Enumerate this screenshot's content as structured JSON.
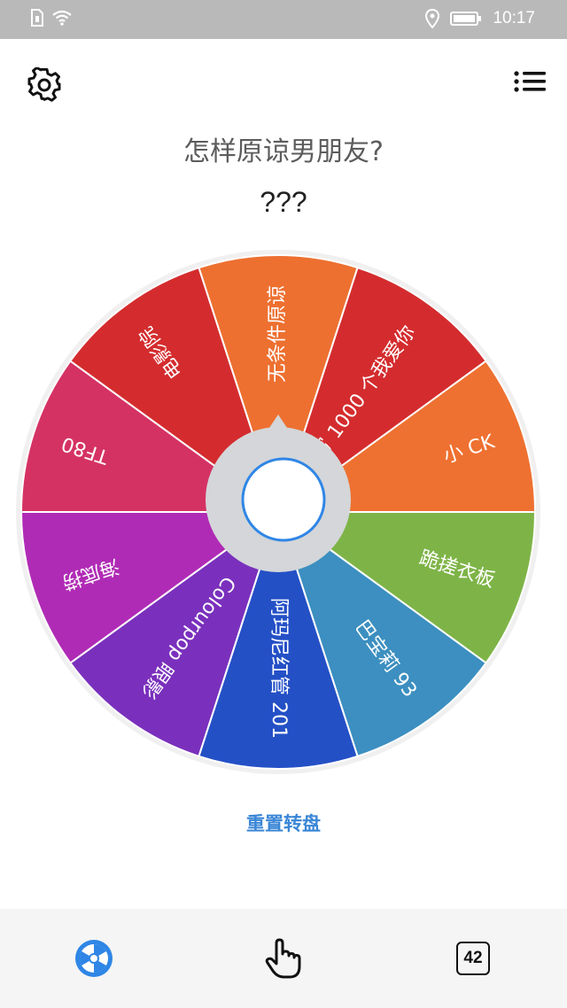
{
  "status_bar": {
    "time": "10:17",
    "icons": [
      "sim-icon",
      "wifi-icon",
      "location-icon",
      "battery-icon"
    ]
  },
  "toolbar": {
    "settings_icon": "gear-icon",
    "menu_icon": "list-icon"
  },
  "question": "怎样原谅男朋友?",
  "result": "???",
  "wheel": {
    "segments": [
      {
        "label": "无条件原谅",
        "color": "#ed7030"
      },
      {
        "label": "写 1000 个我爱你",
        "color": "#d42c2e"
      },
      {
        "label": "小 CK",
        "color": "#ee7131"
      },
      {
        "label": "跪搓衣板",
        "color": "#7eb447"
      },
      {
        "label": "巴宝莉 93",
        "color": "#3c8fc0"
      },
      {
        "label": "阿玛尼红管 201",
        "color": "#2450c6"
      },
      {
        "label": "Colourpop 眼影",
        "color": "#7a30bc"
      },
      {
        "label": "海底捞",
        "color": "#b02bb5"
      },
      {
        "label": "TF80",
        "color": "#d53264"
      },
      {
        "label": "电影院",
        "color": "#d42c2e"
      }
    ]
  },
  "reset_label": "重置转盘",
  "bottom_nav": {
    "items": [
      {
        "name": "wheel",
        "icon": "wheel-icon"
      },
      {
        "name": "tap",
        "icon": "hand-pointer-icon"
      },
      {
        "name": "number",
        "icon": "number-box-icon",
        "value": "42"
      }
    ]
  }
}
